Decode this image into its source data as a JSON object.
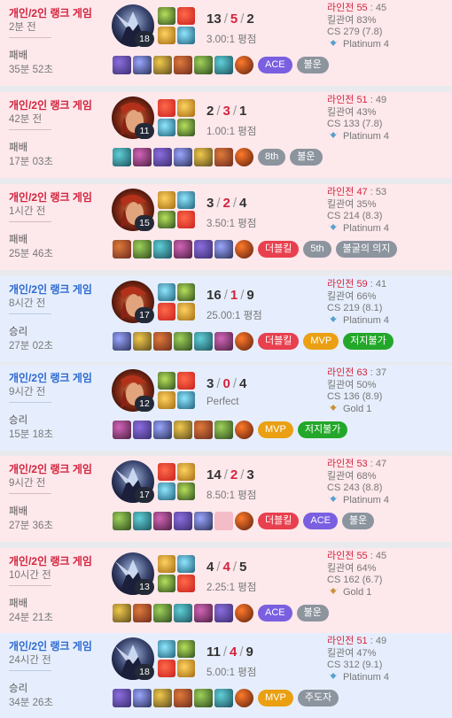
{
  "matches": [
    {
      "result_type": "loss",
      "mode": "개인/2인 랭크 게임",
      "time_ago": "2분 전",
      "result": "패배",
      "duration": "35분 52초",
      "champion": "champion-portrait-dark-assassin",
      "level": "18",
      "kills": "13",
      "deaths": "5",
      "assists": "2",
      "ratio": "3.00:1 평점",
      "lane_label": "라인전",
      "lane_a": "55",
      "lane_b": "45",
      "kp": "킬관여 83%",
      "cs": "CS 279 (7.8)",
      "tier": "Platinum 4",
      "tier_icon": "platinum-icon",
      "items": [
        "item-1",
        "item-2",
        "item-3",
        "item-4",
        "item-5",
        "item-6",
        "ward"
      ],
      "badges": [
        {
          "label": "ACE",
          "kind": "ace"
        },
        {
          "label": "불운",
          "kind": "unlucky"
        }
      ]
    },
    {
      "result_type": "loss",
      "mode": "개인/2인 랭크 게임",
      "time_ago": "42분 전",
      "result": "패배",
      "duration": "17분 03초",
      "champion": "champion-portrait-red-haired",
      "level": "11",
      "kills": "2",
      "deaths": "3",
      "assists": "1",
      "ratio": "1.00:1 평점",
      "lane_label": "라인전",
      "lane_a": "51",
      "lane_b": "49",
      "kp": "킬관여 43%",
      "cs": "CS 133 (7.8)",
      "tier": "Platinum 4",
      "tier_icon": "platinum-icon",
      "items": [
        "item-1",
        "item-2",
        "item-3",
        "item-4",
        "item-5",
        "item-6",
        "ward"
      ],
      "badges": [
        {
          "label": "8th",
          "kind": "place"
        },
        {
          "label": "불운",
          "kind": "unlucky"
        }
      ]
    },
    {
      "result_type": "loss",
      "mode": "개인/2인 랭크 게임",
      "time_ago": "1시간 전",
      "result": "패배",
      "duration": "25분 46초",
      "champion": "champion-portrait-red-haired",
      "level": "15",
      "kills": "3",
      "deaths": "2",
      "assists": "4",
      "ratio": "3.50:1 평점",
      "lane_label": "라인전",
      "lane_a": "47",
      "lane_b": "53",
      "kp": "킬관여 35%",
      "cs": "CS 214 (8.3)",
      "tier": "Platinum 4",
      "tier_icon": "platinum-icon",
      "items": [
        "item-1",
        "item-2",
        "item-3",
        "item-4",
        "item-5",
        "item-6",
        "ward"
      ],
      "badges": [
        {
          "label": "더블킬",
          "kind": "double"
        },
        {
          "label": "5th",
          "kind": "place"
        },
        {
          "label": "불굴의 의지",
          "kind": "ironwill"
        }
      ]
    },
    {
      "result_type": "win",
      "mode": "개인/2인 랭크 게임",
      "time_ago": "8시간 전",
      "result": "승리",
      "duration": "27분 02초",
      "champion": "champion-portrait-red-haired",
      "level": "17",
      "kills": "16",
      "deaths": "1",
      "assists": "9",
      "ratio": "25.00:1 평점",
      "lane_label": "라인전",
      "lane_a": "59",
      "lane_b": "41",
      "kp": "킬관여 66%",
      "cs": "CS 219 (8.1)",
      "tier": "Platinum 4",
      "tier_icon": "platinum-icon",
      "items": [
        "item-1",
        "item-2",
        "item-3",
        "item-4",
        "item-5",
        "item-6",
        "ward"
      ],
      "badges": [
        {
          "label": "더블킬",
          "kind": "double"
        },
        {
          "label": "MVP",
          "kind": "mvp"
        },
        {
          "label": "저지불가",
          "kind": "unstoppable"
        }
      ]
    },
    {
      "result_type": "win",
      "mode": "개인/2인 랭크 게임",
      "time_ago": "9시간 전",
      "result": "승리",
      "duration": "15분 18초",
      "champion": "champion-portrait-red-haired",
      "level": "12",
      "kills": "3",
      "deaths": "0",
      "assists": "4",
      "ratio": "Perfect",
      "lane_label": "라인전",
      "lane_a": "63",
      "lane_b": "37",
      "kp": "킬관여 50%",
      "cs": "CS 136 (8.9)",
      "tier": "Gold 1",
      "tier_icon": "gold-icon",
      "items": [
        "item-1",
        "item-2",
        "item-3",
        "item-4",
        "item-5",
        "item-6",
        "ward"
      ],
      "badges": [
        {
          "label": "MVP",
          "kind": "mvp"
        },
        {
          "label": "저지불가",
          "kind": "unstoppable"
        }
      ]
    },
    {
      "result_type": "loss",
      "mode": "개인/2인 랭크 게임",
      "time_ago": "9시간 전",
      "result": "패배",
      "duration": "27분 36초",
      "champion": "champion-portrait-dark-assassin",
      "level": "17",
      "kills": "14",
      "deaths": "2",
      "assists": "3",
      "ratio": "8.50:1 평점",
      "lane_label": "라인전",
      "lane_a": "53",
      "lane_b": "47",
      "kp": "킬관여 68%",
      "cs": "CS 243 (8.8)",
      "tier": "Platinum 4",
      "tier_icon": "platinum-icon",
      "items": [
        "item-1",
        "item-2",
        "item-3",
        "item-4",
        "item-5",
        "empty",
        "ward"
      ],
      "badges": [
        {
          "label": "더블킬",
          "kind": "double"
        },
        {
          "label": "ACE",
          "kind": "ace"
        },
        {
          "label": "불운",
          "kind": "unlucky"
        }
      ]
    },
    {
      "result_type": "loss",
      "mode": "개인/2인 랭크 게임",
      "time_ago": "10시간 전",
      "result": "패배",
      "duration": "24분 21초",
      "champion": "champion-portrait-dark-assassin",
      "level": "13",
      "kills": "4",
      "deaths": "4",
      "assists": "5",
      "ratio": "2.25:1 평점",
      "lane_label": "라인전",
      "lane_a": "55",
      "lane_b": "45",
      "kp": "킬관여 64%",
      "cs": "CS 162 (6.7)",
      "tier": "Gold 1",
      "tier_icon": "gold-icon",
      "items": [
        "item-1",
        "item-2",
        "item-3",
        "item-4",
        "item-5",
        "item-6",
        "ward"
      ],
      "badges": [
        {
          "label": "ACE",
          "kind": "ace"
        },
        {
          "label": "불운",
          "kind": "unlucky"
        }
      ]
    },
    {
      "result_type": "win",
      "mode": "개인/2인 랭크 게임",
      "time_ago": "24시간 전",
      "result": "승리",
      "duration": "34분 26초",
      "champion": "champion-portrait-dark-assassin",
      "level": "18",
      "kills": "11",
      "deaths": "4",
      "assists": "9",
      "ratio": "5.00:1 평점",
      "lane_label": "라인전",
      "lane_a": "51",
      "lane_b": "49",
      "kp": "킬관여 47%",
      "cs": "CS 312 (9.1)",
      "tier": "Platinum 4",
      "tier_icon": "platinum-icon",
      "items": [
        "item-1",
        "item-2",
        "item-3",
        "item-4",
        "item-5",
        "item-6",
        "ward"
      ],
      "badges": [
        {
          "label": "MVP",
          "kind": "mvp"
        },
        {
          "label": "주도자",
          "kind": "mainplayer"
        }
      ]
    }
  ],
  "colors": {
    "loss_bg": "#fde8ec",
    "win_bg": "#e6eefd",
    "loss_text": "#d3243d",
    "win_text": "#2e6ad0",
    "platinum": "#5aa0c8",
    "gold": "#c8923a"
  }
}
